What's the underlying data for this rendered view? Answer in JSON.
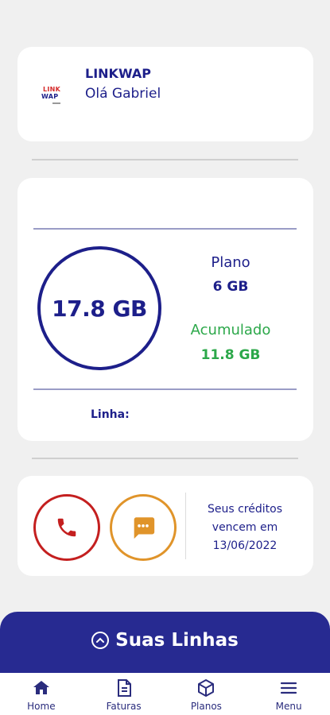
{
  "header": {
    "logo_text_top": "LINK",
    "logo_text_bottom": "WAP",
    "brand": "LINKWAP",
    "greeting": "Olá Gabriel"
  },
  "data_usage": {
    "total": "17.8 GB",
    "plan_label": "Plano",
    "plan_value": "6 GB",
    "accumulated_label": "Acumulado",
    "accumulated_value": "11.8 GB",
    "line_label": "Linha:"
  },
  "actions": {
    "call_icon": "phone-icon",
    "message_icon": "message-icon",
    "credits_text_1": "Seus créditos",
    "credits_text_2": "vencem em",
    "credits_date": "13/06/2022"
  },
  "lines_panel": {
    "title": "Suas Linhas"
  },
  "tabbar": {
    "items": [
      {
        "label": "Home",
        "icon": "home-icon"
      },
      {
        "label": "Faturas",
        "icon": "invoice-icon"
      },
      {
        "label": "Planos",
        "icon": "box-icon"
      },
      {
        "label": "Menu",
        "icon": "menu-icon"
      }
    ]
  },
  "colors": {
    "primary": "#1d1f8a",
    "accent_green": "#2ca84a",
    "call_red": "#c41f1f",
    "message_orange": "#e0942a",
    "bottom_bar": "#272a91"
  }
}
